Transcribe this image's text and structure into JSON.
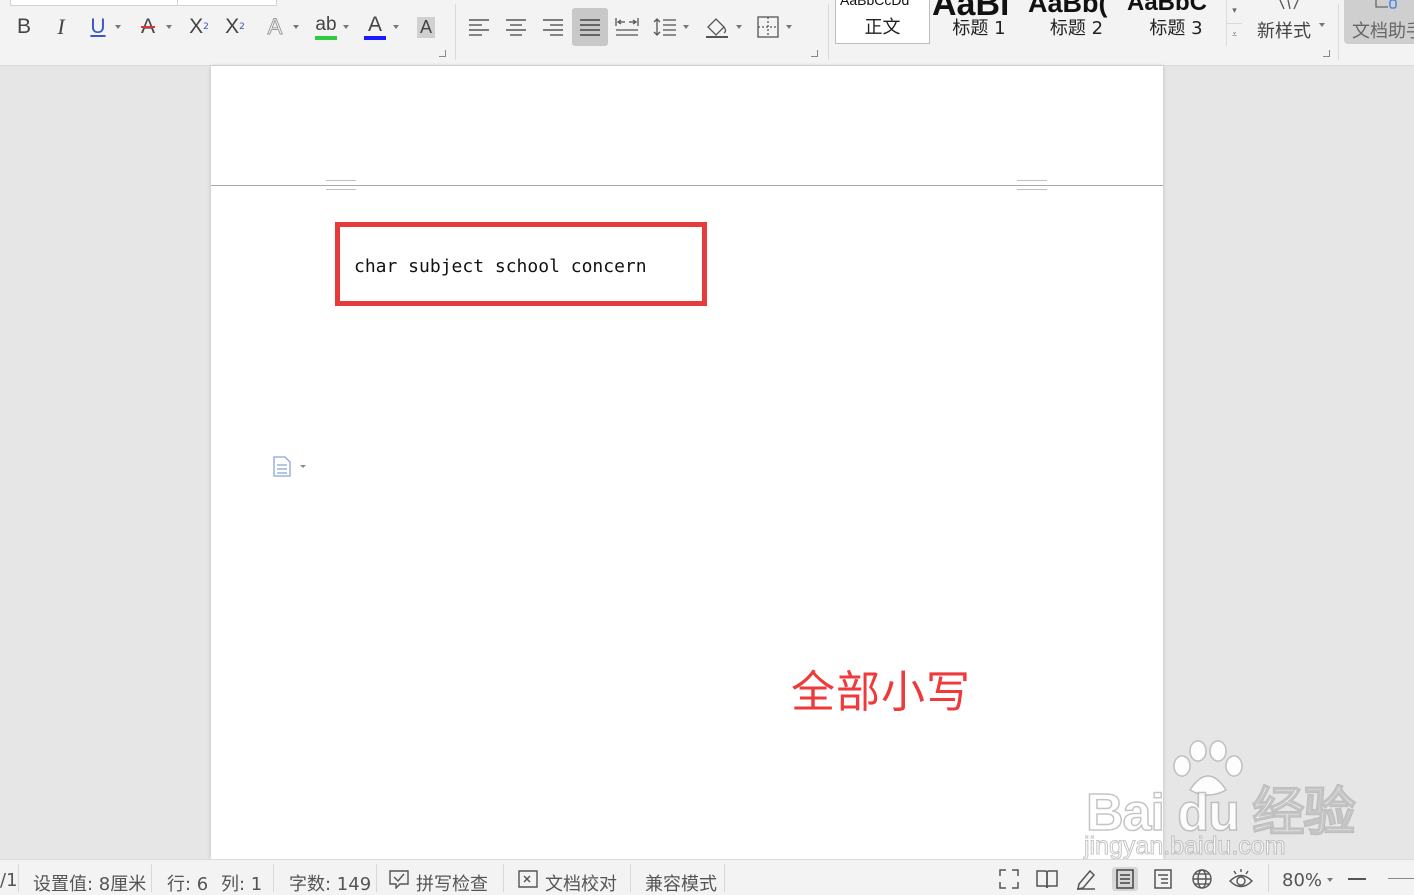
{
  "ribbon": {
    "font_group": {
      "bold": "B",
      "italic": "I",
      "underline": "U",
      "strikethrough": "A",
      "superscript": "X",
      "superscript_mark": "2",
      "subscript": "X",
      "subscript_mark": "2",
      "text_effect": "A",
      "highlight": "ab",
      "font_color": "A",
      "char_shading": "A",
      "colors": {
        "highlight": "#2ecc40",
        "font_color": "#1a1aff"
      }
    },
    "paragraph_group": {
      "icons": [
        "align-left-icon",
        "align-center-icon",
        "align-right-icon",
        "justify-icon",
        "distribute-icon",
        "line-spacing-icon",
        "shading-icon",
        "borders-icon"
      ],
      "active": "justify-icon"
    },
    "styles": {
      "items": [
        {
          "preview": "AaBbCcDd",
          "label": "正文",
          "selected": true
        },
        {
          "preview": "AaBl",
          "label": "标题 1",
          "selected": false
        },
        {
          "preview": "AaBb(",
          "label": "标题 2",
          "selected": false
        },
        {
          "preview": "AaBbC",
          "label": "标题 3",
          "selected": false
        }
      ],
      "new_style": "新样式",
      "doc_helper": "文档助手"
    }
  },
  "document": {
    "text": "char subject school concern",
    "annotation": "全部小写",
    "annotation_color": "#ee3a3b",
    "highlight_color": "#e8393b"
  },
  "watermark": {
    "logo": "Bai du 经验",
    "url": "jingyan.baidu.com"
  },
  "status_bar": {
    "page_fragment": "/1",
    "setting_value": "设置值: 8厘米",
    "row": "行: 6",
    "column": "列: 1",
    "word_count": "字数: 149",
    "spell_check": "拼写检查",
    "proofread": "文档校对",
    "compat_mode": "兼容模式",
    "zoom": "80%"
  }
}
